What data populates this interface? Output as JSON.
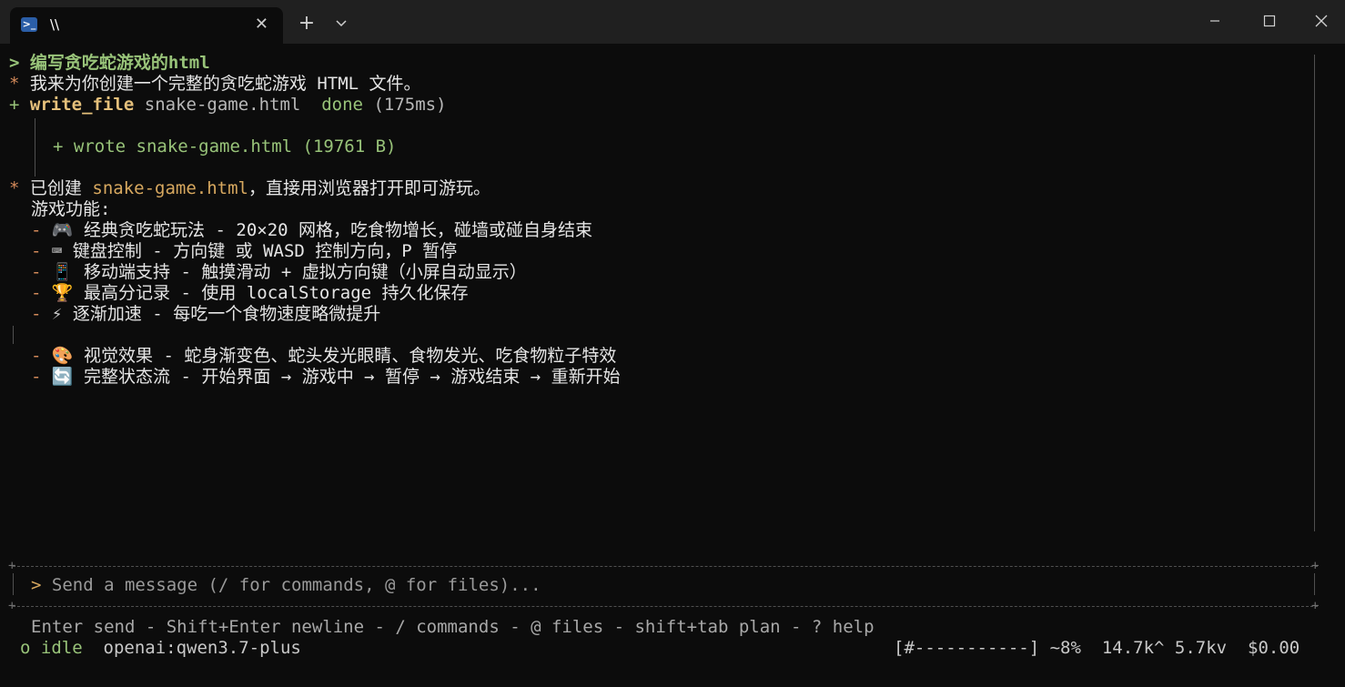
{
  "window": {
    "tab_title": "\\\\",
    "tab_icon": "powershell-icon",
    "new_tab_label": "+"
  },
  "conversation": {
    "user_prompt_marker": ">",
    "user_prompt": "编写贪吃蛇游戏的html",
    "assistant_marker": "*",
    "assistant_intro": "我来为你创建一个完整的贪吃蛇游戏 HTML 文件。",
    "tool_call": {
      "marker": "+",
      "name": "write_file",
      "arg": "snake-game.html",
      "status": "done",
      "duration": "(175ms)",
      "result": "+ wrote snake-game.html (19761 B)"
    },
    "summary": {
      "marker": "*",
      "prefix": "已创建",
      "file": "snake-game.html",
      "suffix": "，直接用浏览器打开即可游玩。",
      "features_heading": "游戏功能:",
      "features": [
        {
          "icon": "🎮",
          "icon_name": "game-controller-icon",
          "title": "经典贪吃蛇玩法",
          "desc": "20×20 网格，吃食物增长，碰墙或碰自身结束"
        },
        {
          "icon": "⌨",
          "icon_name": "keyboard-icon",
          "title": "键盘控制",
          "desc": "方向键 或 WASD 控制方向，P 暂停"
        },
        {
          "icon": "📱",
          "icon_name": "mobile-phone-icon",
          "title": "移动端支持",
          "desc": "触摸滑动 + 虚拟方向键（小屏自动显示）"
        },
        {
          "icon": "🏆",
          "icon_name": "trophy-icon",
          "title": "最高分记录",
          "desc": "使用 localStorage 持久化保存"
        },
        {
          "icon": "⚡",
          "icon_name": "lightning-icon",
          "title": "逐渐加速",
          "desc": "每吃一个食物速度略微提升"
        },
        {
          "icon": "🎨",
          "icon_name": "palette-icon",
          "title": "视觉效果",
          "desc": "蛇身渐变色、蛇头发光眼睛、食物发光、吃食物粒子特效"
        },
        {
          "icon": "🔄",
          "icon_name": "refresh-icon",
          "title": "完整状态流",
          "desc": "开始界面 → 游戏中 → 暂停 → 游戏结束 → 重新开始"
        }
      ]
    }
  },
  "input": {
    "prompt": ">",
    "placeholder": "Send a message (/ for commands, @ for files)..."
  },
  "help_line": "Enter send - Shift+Enter newline - / commands - @ files - shift+tab plan - ? help",
  "status": {
    "state": "o idle",
    "model": "openai:qwen3.7-plus",
    "context_bar": "[#-----------]",
    "context_percent": "~8%",
    "tokens_in": "14.7k^",
    "tokens_out": "5.7kv",
    "cost": "$0.00",
    "context_fraction": 0.08
  },
  "colors": {
    "background": "#0c0c0c",
    "titlebar": "#202020",
    "green": "#98c379",
    "tool_yellow": "#e5c07b",
    "orange": "#d48a5a"
  }
}
